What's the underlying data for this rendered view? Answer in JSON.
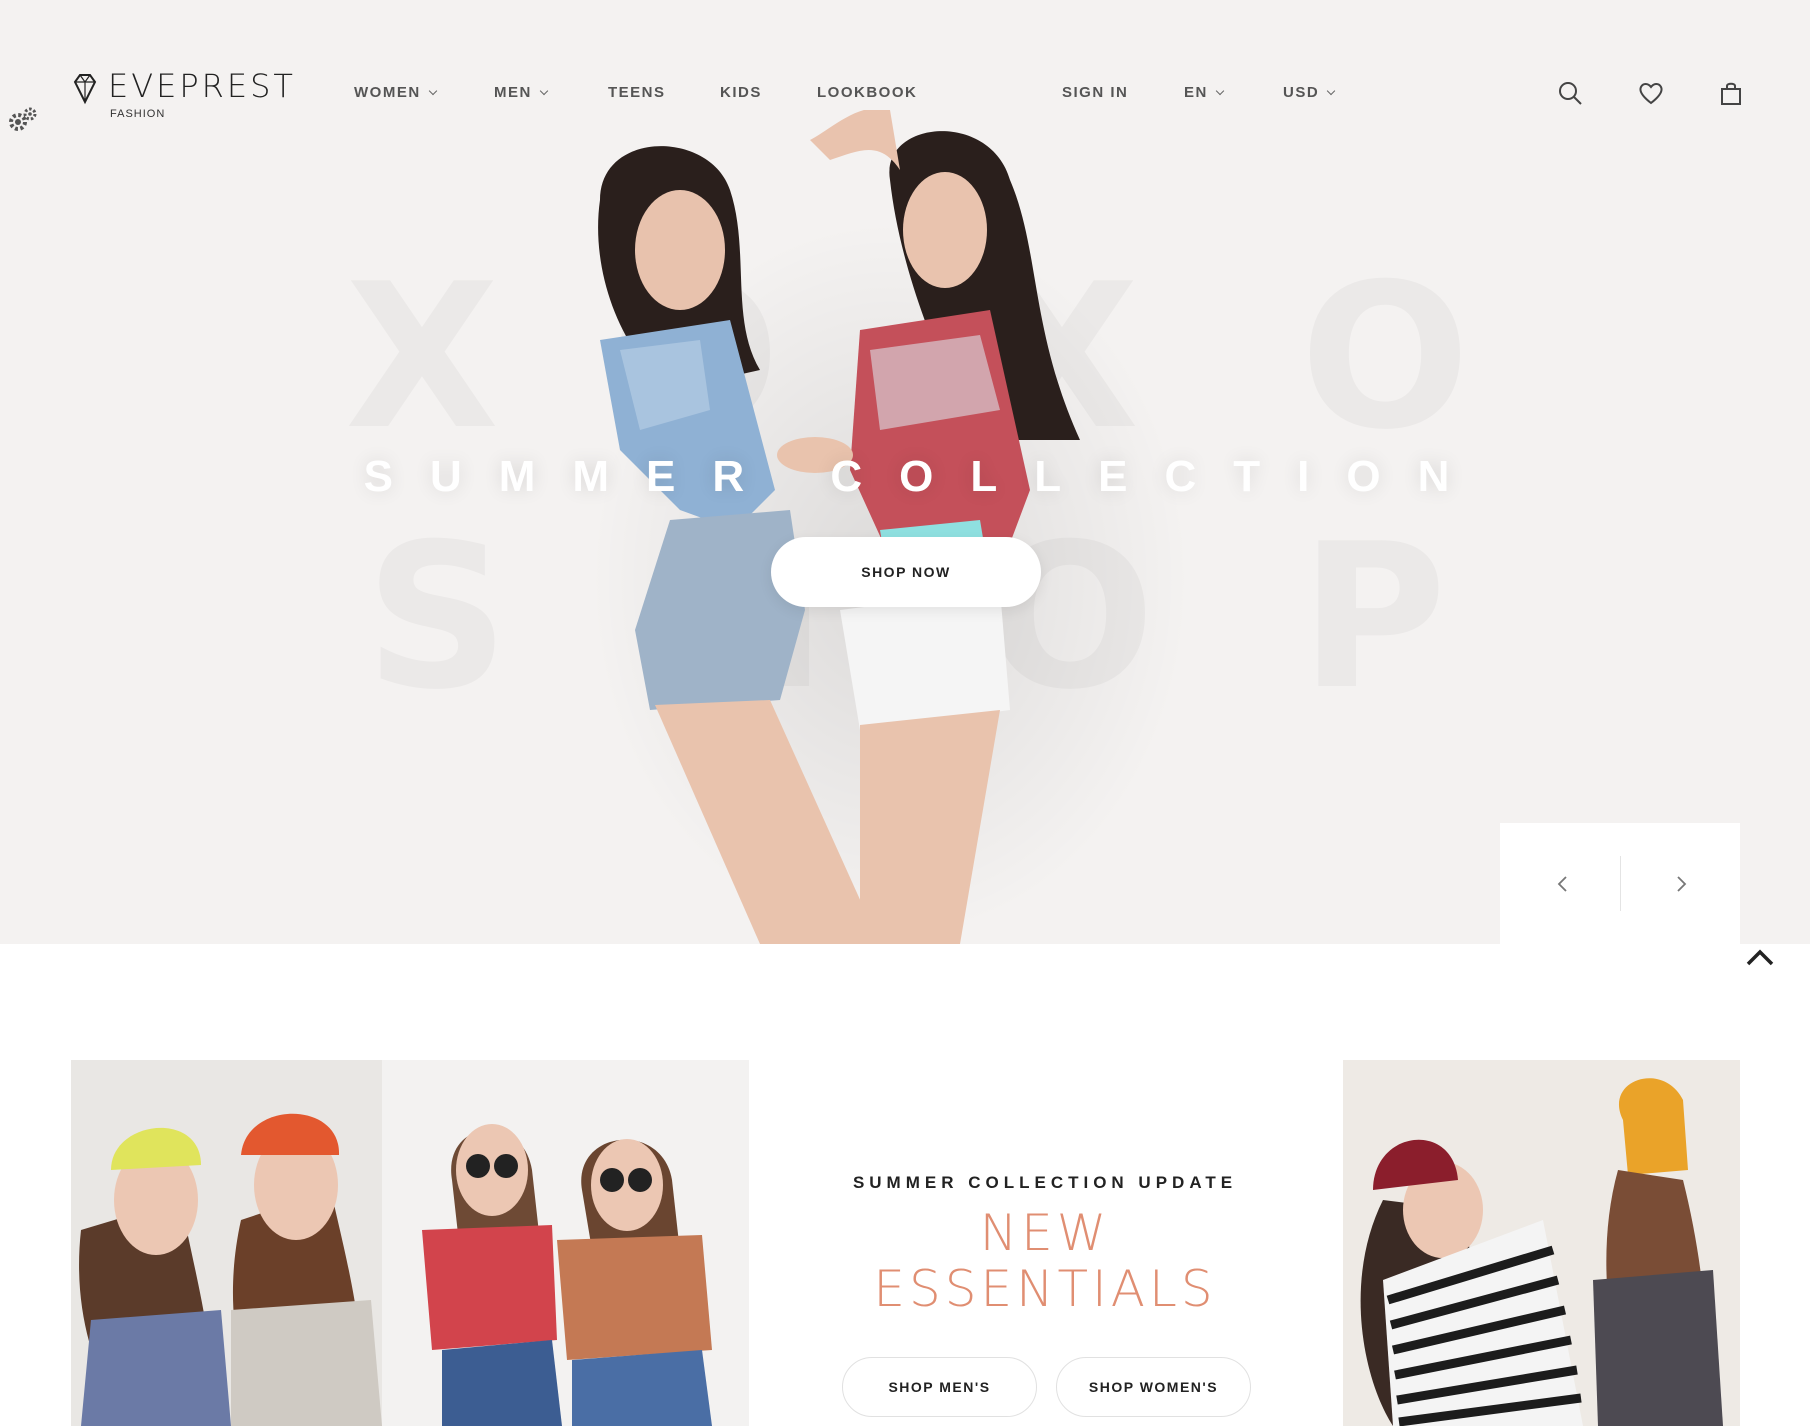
{
  "brand": {
    "name": "EVEPREST",
    "tagline": "FASHION"
  },
  "nav": {
    "items": [
      {
        "label": "WOMEN",
        "dropdown": true
      },
      {
        "label": "MEN",
        "dropdown": true
      },
      {
        "label": "TEENS",
        "dropdown": false
      },
      {
        "label": "KIDS",
        "dropdown": false
      },
      {
        "label": "LOOKBOOK",
        "dropdown": false
      }
    ],
    "sign_in": "SIGN IN",
    "language": "EN",
    "currency": "USD"
  },
  "header_icons": [
    "search-icon",
    "heart-icon",
    "shopping-bag-icon"
  ],
  "hero": {
    "bg_letters": [
      "X",
      "O",
      "X",
      "O",
      "S",
      "H",
      "O",
      "P"
    ],
    "headline": "SUMMER COLLECTION",
    "cta": "SHOP NOW"
  },
  "promo": {
    "subtitle": "SUMMER COLLECTION UPDATE",
    "title_line1": "NEW",
    "title_line2": "ESSENTIALS",
    "button_men": "SHOP MEN'S",
    "button_women": "SHOP WOMEN'S"
  },
  "colors": {
    "hero_bg": "#f4f2f1",
    "accent": "#e08e72",
    "text_dark": "#222222",
    "nav_text": "#555555"
  }
}
